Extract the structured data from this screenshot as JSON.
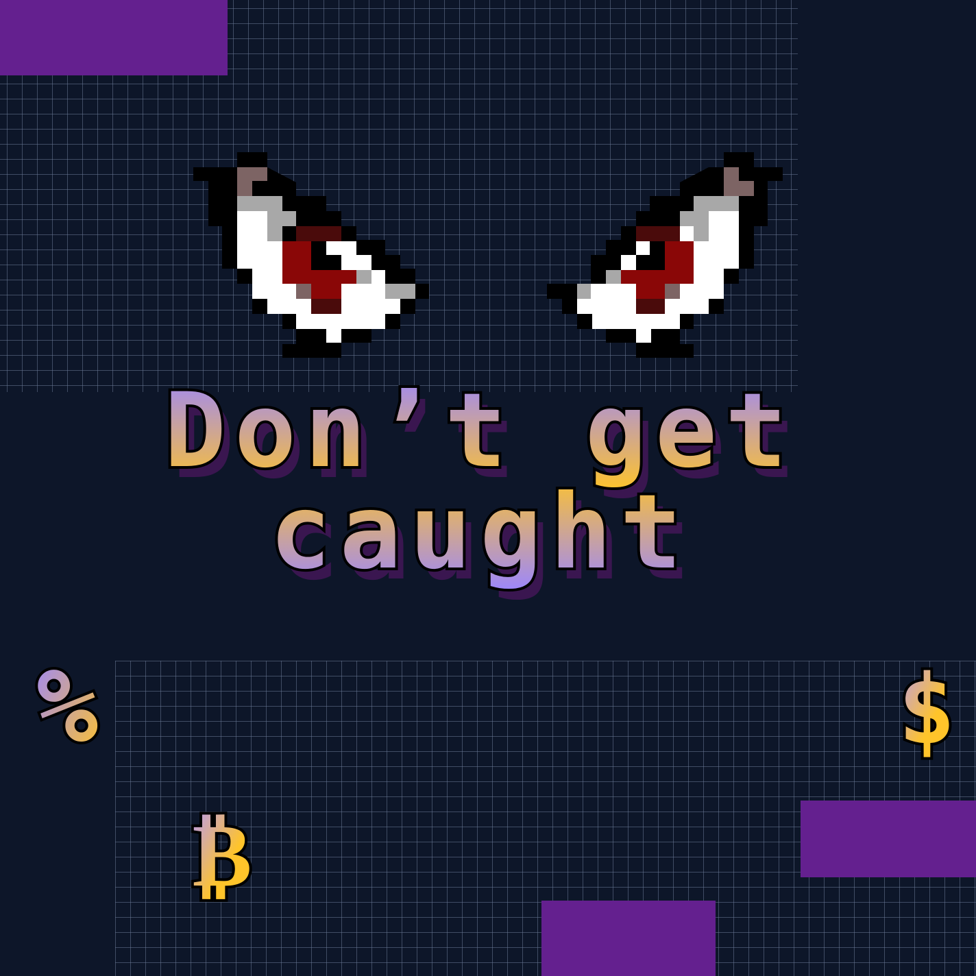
{
  "title": {
    "line1": "Don’t get",
    "line2": "caught"
  },
  "symbols": {
    "percent": "%",
    "dollar": "$",
    "bitcoin": "₿"
  },
  "colors": {
    "background": "#0d1629",
    "grid_line": "#5a6a86",
    "purple_block": "#64208f",
    "text_gradient_purple": "#9b86ff",
    "text_gradient_gold": "#ffc42a",
    "text_shadow": "#3a1650",
    "text_outline": "#000000",
    "eye_white": "#ffffff",
    "eye_iris": "#8a0707",
    "eye_iris_dark": "#4a0b0b",
    "eye_gray": "#a8a8a8",
    "eye_brown": "#7d6464"
  },
  "icons": [
    "eye-left-icon",
    "eye-right-icon",
    "percent-icon",
    "dollar-icon",
    "bitcoin-icon"
  ]
}
